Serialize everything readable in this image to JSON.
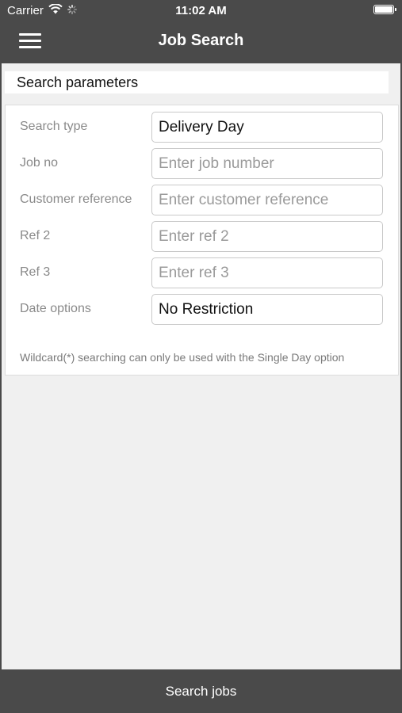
{
  "status_bar": {
    "carrier": "Carrier",
    "time": "11:02 AM",
    "icons": [
      "wifi-icon",
      "activity-spinner-icon",
      "battery-icon"
    ]
  },
  "nav": {
    "title": "Job Search",
    "menu_icon": "hamburger-menu-icon"
  },
  "section": {
    "title": "Search parameters"
  },
  "form": {
    "search_type": {
      "label": "Search type",
      "value": "Delivery Day"
    },
    "job_no": {
      "label": "Job no",
      "placeholder": "Enter job number"
    },
    "customer_reference": {
      "label": "Customer reference",
      "placeholder": "Enter customer reference"
    },
    "ref2": {
      "label": "Ref 2",
      "placeholder": "Enter ref 2"
    },
    "ref3": {
      "label": "Ref 3",
      "placeholder": "Enter ref 3"
    },
    "date_options": {
      "label": "Date options",
      "value": "No Restriction"
    },
    "note": "Wildcard(*) searching can only be used with the Single Day option"
  },
  "bottom_bar": {
    "action_label": "Search jobs"
  },
  "colors": {
    "bar_background": "#4a4a4a",
    "content_background": "#f0f0f0",
    "label_text": "#8a8a8a"
  }
}
